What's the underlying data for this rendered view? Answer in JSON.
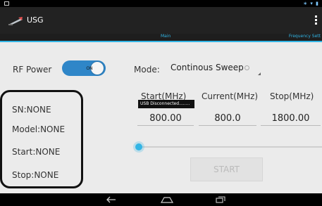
{
  "app": {
    "title": "USG"
  },
  "tabs": {
    "main": "Main",
    "frequency": "Frequency Sett"
  },
  "rf_power": {
    "label": "RF Power",
    "toggle_text": "ON"
  },
  "mode": {
    "label": "Mode:",
    "value": "Continous Sweep"
  },
  "device_info": [
    {
      "text": "SN:NONE"
    },
    {
      "text": "Model:NONE"
    },
    {
      "text": "Start:NONE"
    },
    {
      "text": "Stop:NONE"
    }
  ],
  "columns": [
    {
      "header": "Start(MHz)",
      "value": "800.00"
    },
    {
      "header": "Current(MHz)",
      "value": "800.0"
    },
    {
      "header": "Stop(MHz)",
      "value": "1800.00"
    }
  ],
  "toast": {
    "text": "USB Disconnected........"
  },
  "slider": {
    "value_fraction": 0.0
  },
  "start_button": {
    "label": "START"
  },
  "colors": {
    "accent": "#33b5e5",
    "toggle_on": "#2f86c8",
    "background": "#ebebeb",
    "actionbar": "#222222"
  }
}
